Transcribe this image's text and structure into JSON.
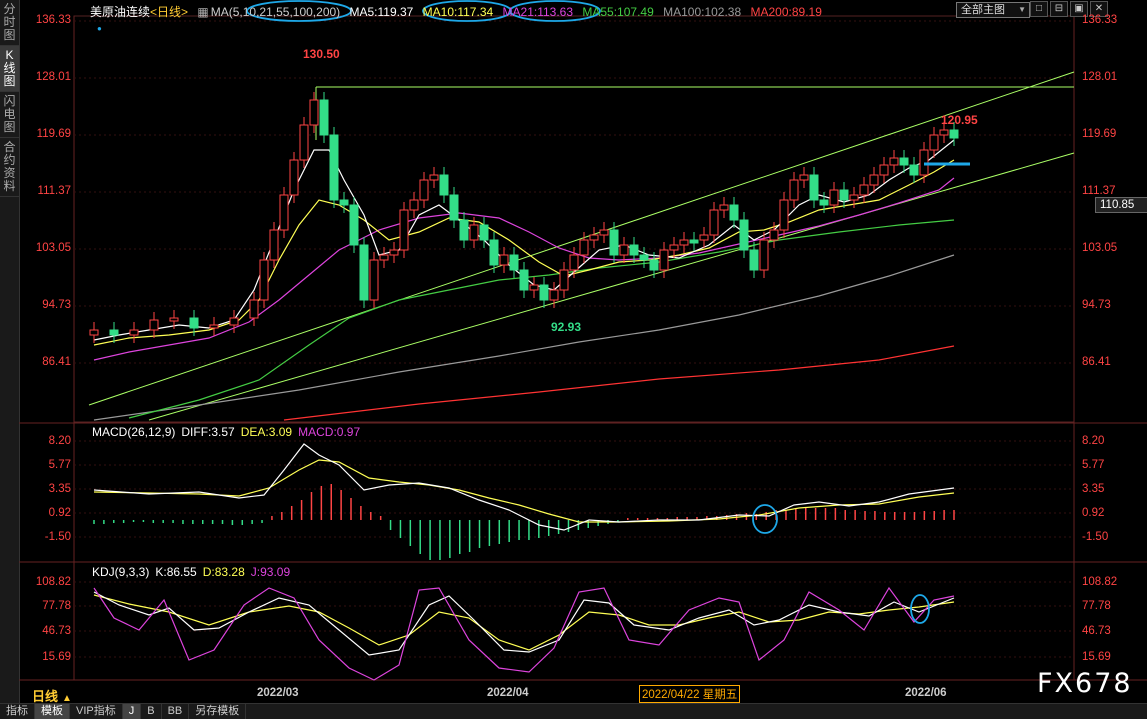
{
  "sidebar": {
    "tabs": [
      {
        "label": "分时图",
        "active": false
      },
      {
        "label": "K线图",
        "active": true
      },
      {
        "label": "闪电图",
        "active": false
      },
      {
        "label": "合约资料",
        "active": false
      }
    ]
  },
  "header": {
    "instrument": "美原油连续",
    "period_tag": "<日线>",
    "ma_params": "MA(5,10,21,55,100,200)",
    "ma5": "MA5:119.37",
    "ma10": "MA10:117.34",
    "ma21": "MA21:113.63",
    "ma55": "MA55:107.49",
    "ma100": "MA100:102.38",
    "ma200": "MA200:89.19",
    "dropdown_value": "全部主图",
    "win_buttons": [
      "□",
      "⊟",
      "▣",
      "✕"
    ]
  },
  "colors": {
    "up": "#ff4444",
    "down": "#33dd88",
    "ma5": "#ffffff",
    "ma10": "#ffff55",
    "ma21": "#dd44dd",
    "ma55": "#44cc44",
    "ma100": "#999999",
    "ma200": "#ff3333",
    "channel": "#aaff66",
    "highlight": "#1ea8e8"
  },
  "price_axis": {
    "ticks": [
      "136.33",
      "128.01",
      "119.69",
      "111.37",
      "103.05",
      "94.73",
      "86.41"
    ],
    "current": "110.85",
    "annotations": {
      "high": "130.50",
      "recent_high": "120.95",
      "low": "92.93"
    }
  },
  "macd": {
    "label": "MACD(26,12,9)",
    "diff": "DIFF:3.57",
    "dea": "DEA:3.09",
    "macd": "MACD:0.97",
    "ticks": [
      "8.20",
      "5.77",
      "3.35",
      "0.92",
      "-1.50"
    ]
  },
  "kdj": {
    "label": "KDJ(9,3,3)",
    "k": "K:86.55",
    "d": "D:83.28",
    "j": "J:93.09",
    "ticks": [
      "108.82",
      "77.78",
      "46.73",
      "15.69"
    ]
  },
  "time_axis": {
    "period": "日线",
    "dates": [
      "2022/03",
      "2022/04",
      "2022/06"
    ],
    "hover_date": "2022/04/22 星期五"
  },
  "bottom_tabs": [
    {
      "label": "指标",
      "active": false
    },
    {
      "label": "模板",
      "active": true
    },
    {
      "label": "VIP指标",
      "active": false
    },
    {
      "label": "J",
      "active": true
    },
    {
      "label": "B",
      "active": false
    },
    {
      "label": "BB",
      "active": false
    },
    {
      "label": "另存模板",
      "active": false
    }
  ],
  "watermark": "FX678"
}
